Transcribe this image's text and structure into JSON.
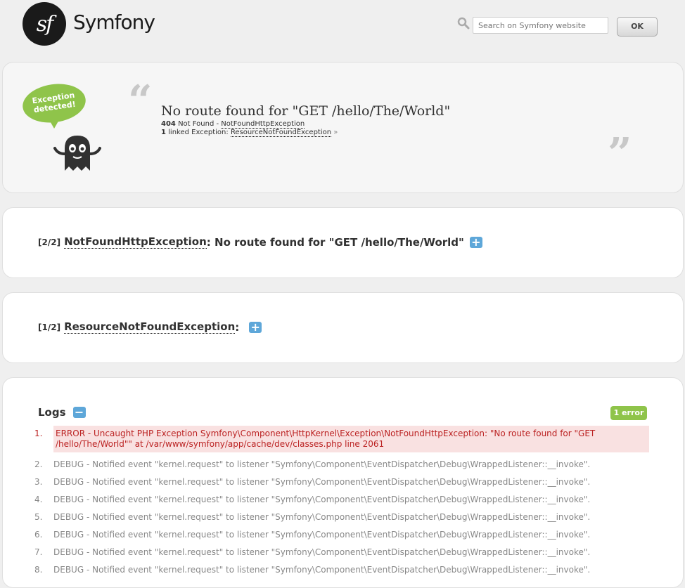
{
  "header": {
    "logo_mark": "sf",
    "brand": "Symfony",
    "search_placeholder": "Search on Symfony website",
    "ok_label": "OK"
  },
  "exception": {
    "bubble_line1": "Exception",
    "bubble_line2": "detected!",
    "title": "No route found for \"GET /hello/The/World\"",
    "status_code": "404",
    "status_text": "Not Found -",
    "status_class": "NotFoundHttpException",
    "linked_count": "1",
    "linked_text": "linked Exception:",
    "linked_class": "ResourceNotFoundException",
    "linked_raquo": "»"
  },
  "traces": [
    {
      "index": "[2/2]",
      "class": "NotFoundHttpException",
      "message": ": No route found for \"GET /hello/The/World\"",
      "toggle": "+"
    },
    {
      "index": "[1/2]",
      "class": "ResourceNotFoundException",
      "message": ":",
      "toggle": "+"
    }
  ],
  "logs": {
    "title": "Logs",
    "toggle": "−",
    "badge": "1 error",
    "items": [
      {
        "num": "1.",
        "text": "ERROR - Uncaught PHP Exception Symfony\\Component\\HttpKernel\\Exception\\NotFoundHttpException: \"No route found for \"GET /hello/The/World\"\" at /var/www/symfony/app/cache/dev/classes.php line 2061"
      },
      {
        "num": "2.",
        "text": "DEBUG - Notified event \"kernel.request\" to listener \"Symfony\\Component\\EventDispatcher\\Debug\\WrappedListener::__invoke\"."
      },
      {
        "num": "3.",
        "text": "DEBUG - Notified event \"kernel.request\" to listener \"Symfony\\Component\\EventDispatcher\\Debug\\WrappedListener::__invoke\"."
      },
      {
        "num": "4.",
        "text": "DEBUG - Notified event \"kernel.request\" to listener \"Symfony\\Component\\EventDispatcher\\Debug\\WrappedListener::__invoke\"."
      },
      {
        "num": "5.",
        "text": "DEBUG - Notified event \"kernel.request\" to listener \"Symfony\\Component\\EventDispatcher\\Debug\\WrappedListener::__invoke\"."
      },
      {
        "num": "6.",
        "text": "DEBUG - Notified event \"kernel.request\" to listener \"Symfony\\Component\\EventDispatcher\\Debug\\WrappedListener::__invoke\"."
      },
      {
        "num": "7.",
        "text": "DEBUG - Notified event \"kernel.request\" to listener \"Symfony\\Component\\EventDispatcher\\Debug\\WrappedListener::__invoke\"."
      },
      {
        "num": "8.",
        "text": "DEBUG - Notified event \"kernel.request\" to listener \"Symfony\\Component\\EventDispatcher\\Debug\\WrappedListener::__invoke\"."
      }
    ]
  },
  "colors": {
    "accent_green": "#8fc44a",
    "toggle_blue": "#5ea7d9",
    "error_red": "#b22222",
    "error_bg": "#f9e1e1"
  }
}
